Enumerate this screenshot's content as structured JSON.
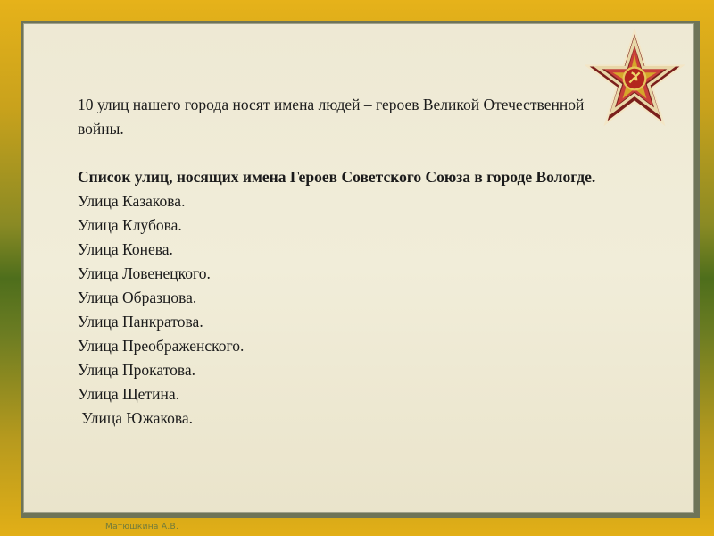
{
  "intro": "10 улиц нашего города носят имена людей – героев Великой Отечественной войны.",
  "list_title": "Список улиц, носящих имена Героев Советского Союза в городе Вологде.",
  "streets": [
    "Улица Казакова.",
    "Улица Клубова.",
    "Улица Конева.",
    "Улица Ловенецкого.",
    "Улица Образцова.",
    "Улица Панкратова.",
    "Улица Преображенского.",
    "Улица Прокатова.",
    "Улица Щетина.",
    " Улица Южакова."
  ],
  "author": "Матюшкина А.В.",
  "emblem_icon": "order-of-patriotic-war-star-icon",
  "colors": {
    "background_yellow": "#e6b21a",
    "background_green": "#4e6e1c",
    "panel": "#eee9d4",
    "star_red": "#b3261e"
  }
}
